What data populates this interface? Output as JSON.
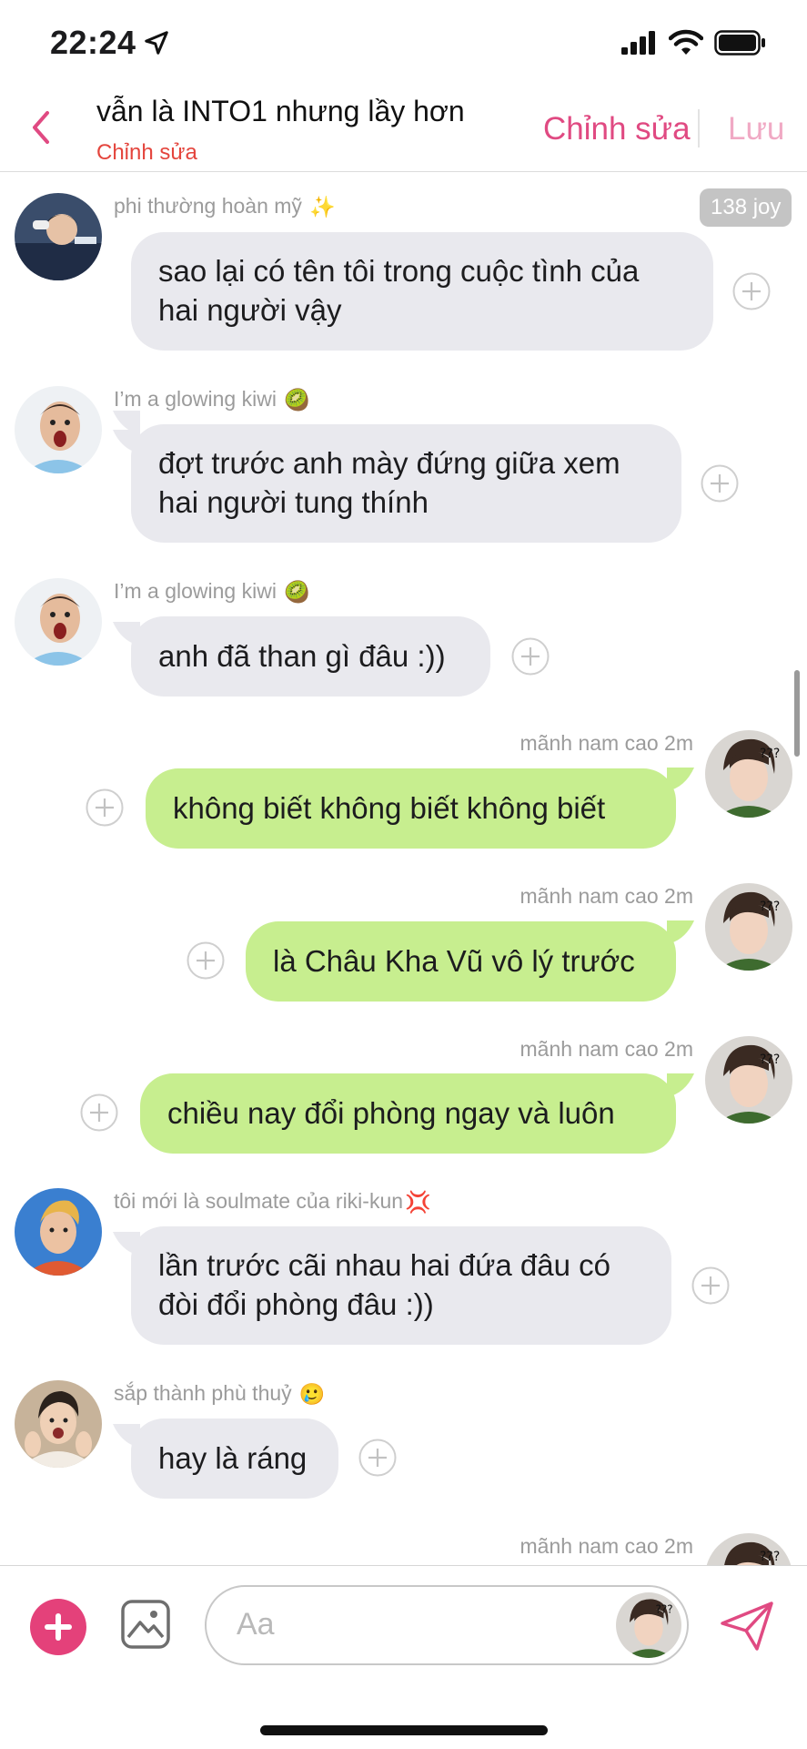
{
  "status_bar": {
    "time": "22:24",
    "location_icon": "location-arrow-icon",
    "signal_icon": "cellular-signal-icon",
    "wifi_icon": "wifi-icon",
    "battery_icon": "battery-icon"
  },
  "nav": {
    "title": "vẫn là INTO1 nhưng lầy hơn",
    "subtitle": "Chỉnh sửa",
    "edit_label": "Chỉnh sửa",
    "save_label": "Lưu",
    "accent_color": "#e04a82"
  },
  "joy_badge": "138 joy",
  "messages": [
    {
      "sender": "phi thường hoàn mỹ",
      "sender_emoji": "✨",
      "text_lines": [
        "sao lại có tên tôi trong cuộc tình của",
        "hai người vậy"
      ],
      "direction": "incoming"
    },
    {
      "sender": "I’m a glowing kiwi",
      "sender_emoji": "🥝",
      "text_lines": [
        "đợt trước anh mày đứng giữa xem",
        "hai người tung thính"
      ],
      "direction": "incoming"
    },
    {
      "sender": "I’m a glowing kiwi",
      "sender_emoji": "🥝",
      "text_lines": [
        "anh đã than gì đâu :))"
      ],
      "direction": "incoming"
    },
    {
      "sender": "mãnh nam cao",
      "time": "2m",
      "text_lines": [
        "không biết không biết không biết"
      ],
      "direction": "outgoing"
    },
    {
      "sender": "mãnh nam cao",
      "time": "2m",
      "text_lines": [
        "là Châu Kha Vũ vô lý trước"
      ],
      "direction": "outgoing"
    },
    {
      "sender": "mãnh nam cao",
      "time": "2m",
      "text_lines": [
        "chiều nay đổi phòng ngay và luôn"
      ],
      "direction": "outgoing"
    },
    {
      "sender": "tôi mới là soulmate của riki-kun",
      "sender_emoji": "💢",
      "text_lines": [
        "lần trước cãi nhau hai đứa đâu có",
        "đòi đổi phòng đâu :))"
      ],
      "direction": "incoming"
    },
    {
      "sender": "sắp thành phù thuỷ",
      "sender_emoji": "🥲",
      "text_lines": [
        "hay là ráng"
      ],
      "direction": "incoming"
    },
    {
      "sender": "mãnh nam cao",
      "time": "2m",
      "text_lines": [],
      "direction": "outgoing"
    }
  ],
  "composer": {
    "placeholder": "Aa",
    "add_icon": "plus-circle-icon",
    "image_icon": "image-icon",
    "send_icon": "send-icon"
  },
  "colors": {
    "incoming_bubble": "#e9e9ee",
    "outgoing_bubble": "#c7ee8f",
    "add_button": "#e4417a"
  }
}
